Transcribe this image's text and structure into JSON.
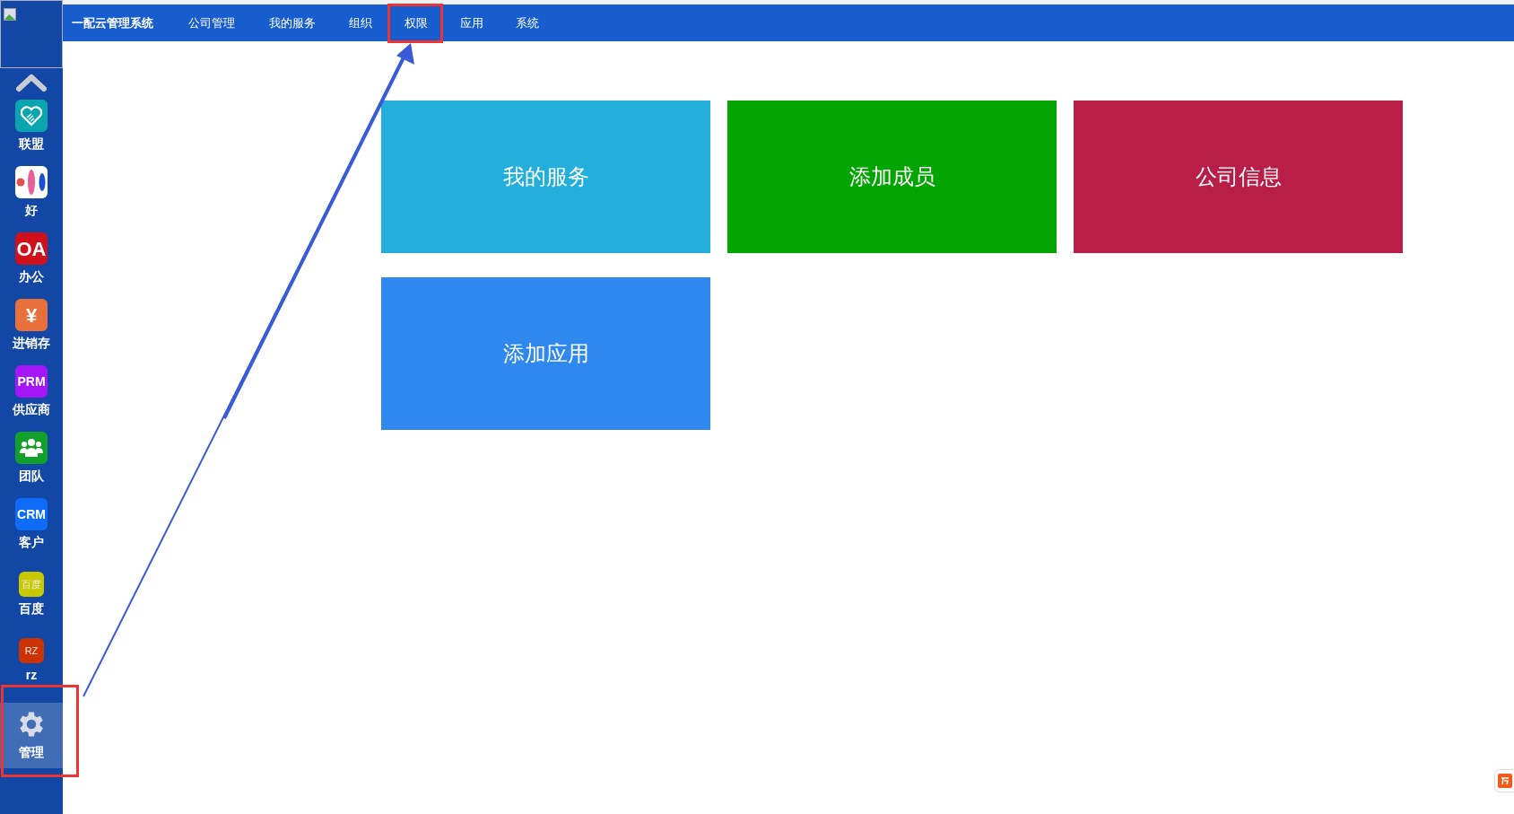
{
  "top_nav": {
    "brand": "一配云管理系统",
    "items": [
      {
        "label": "公司管理",
        "selected": false
      },
      {
        "label": "我的服务",
        "selected": false
      },
      {
        "label": "组织",
        "selected": false
      },
      {
        "label": "权限",
        "selected": false
      },
      {
        "label": "应用",
        "selected": false
      },
      {
        "label": "系统",
        "selected": false
      }
    ]
  },
  "sidebar": {
    "items": [
      {
        "kind": "handshake",
        "label": "联盟",
        "color": "#0aa6b0",
        "selected": false
      },
      {
        "kind": "image",
        "label": "好",
        "color": "#ffffff",
        "selected": false
      },
      {
        "kind": "text",
        "icon_text": "OA",
        "label": "办公",
        "color": "#d0101a",
        "selected": false
      },
      {
        "kind": "text",
        "icon_text": "¥",
        "label": "进销存",
        "color": "#e8703a",
        "selected": false
      },
      {
        "kind": "text",
        "icon_text": "PRM",
        "label": "供应商",
        "color": "#a416f5",
        "selected": false
      },
      {
        "kind": "people",
        "label": "团队",
        "color": "#12a02a",
        "selected": false
      },
      {
        "kind": "text",
        "icon_text": "CRM",
        "label": "客户",
        "color": "#0e6cf8",
        "selected": false
      },
      {
        "kind": "small",
        "icon_text": "百度",
        "label": "百度",
        "color": "#c8c800",
        "selected": false
      },
      {
        "kind": "small",
        "icon_text": "RZ",
        "label": "rz",
        "color": "#cc3300",
        "selected": false
      },
      {
        "kind": "gear",
        "label": "管理",
        "color": "#d8dce6",
        "selected": true
      }
    ]
  },
  "tiles": [
    {
      "label": "我的服务",
      "color": "#23aedc"
    },
    {
      "label": "添加成员",
      "color": "#02a502"
    },
    {
      "label": "公司信息",
      "color": "#b81e48"
    },
    {
      "label": "添加应用",
      "color": "#2e88ee"
    }
  ]
}
